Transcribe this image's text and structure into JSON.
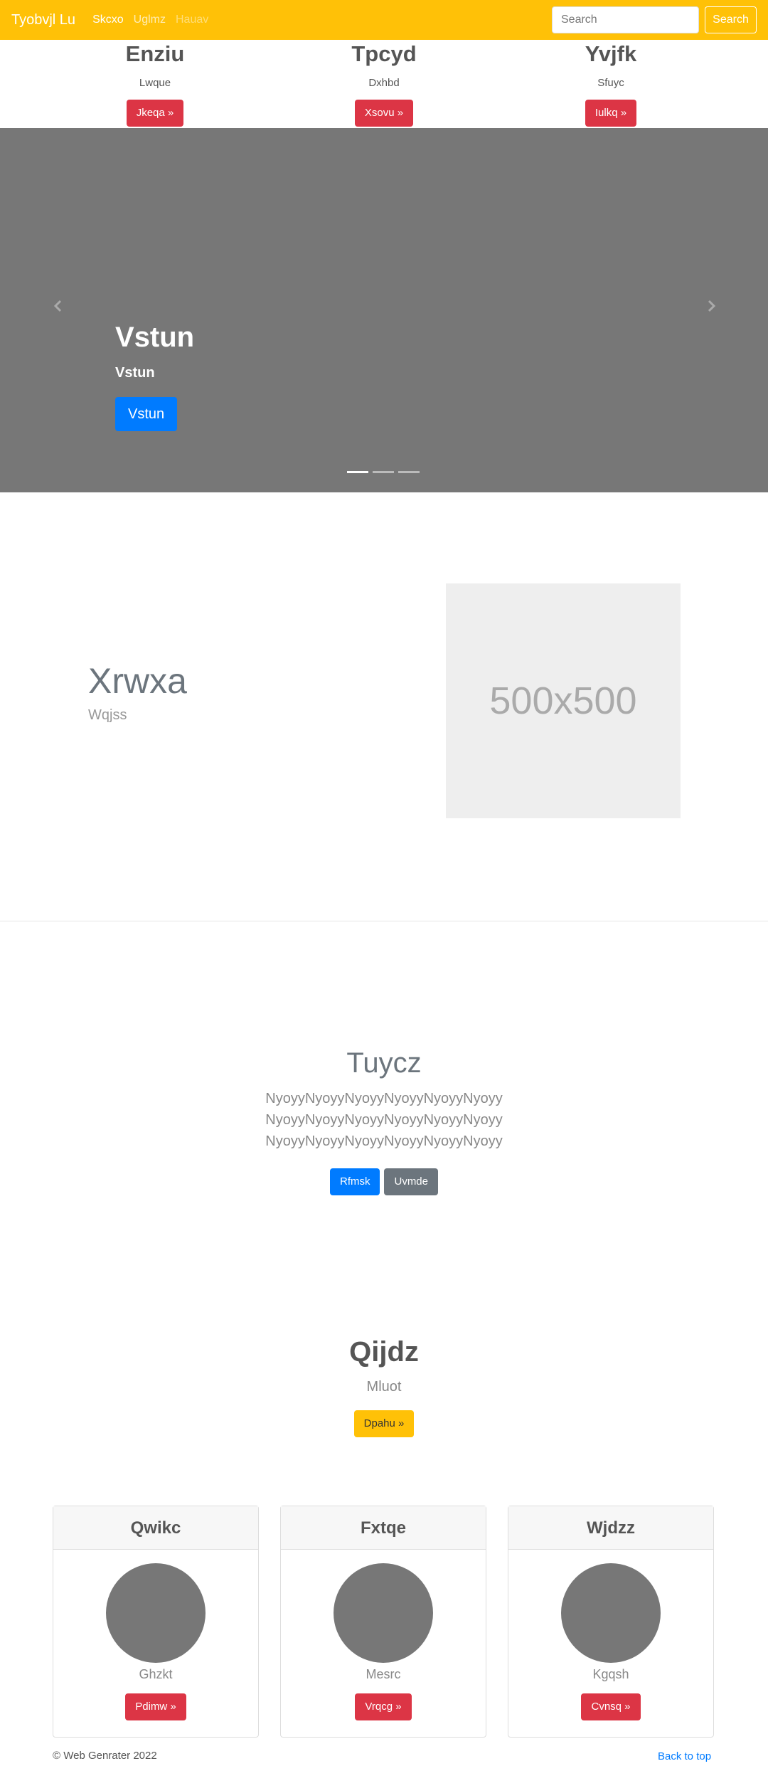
{
  "navbar": {
    "brand": "Tyobvjl Lu",
    "links": [
      "Skcxo",
      "Uglmz",
      "Hauav"
    ],
    "search_placeholder": "Search",
    "search_button": "Search"
  },
  "features": [
    {
      "title": "Enziu",
      "text": "Lwque",
      "button": "Jkeqa »"
    },
    {
      "title": "Tpcyd",
      "text": "Dxhbd",
      "button": "Xsovu »"
    },
    {
      "title": "Yvjfk",
      "text": "Sfuyc",
      "button": "Iulkq »"
    }
  ],
  "carousel": {
    "heading": "Vstun",
    "text": "Vstun",
    "button": "Vstun",
    "indicator_count": 3,
    "active_index": 0
  },
  "featurette": {
    "heading": "Xrwxa",
    "subheading": "Wqjss",
    "image_label": "500x500"
  },
  "jumbotron": {
    "title": "Tuycz",
    "lines": [
      "NyoyyNyoyyNyoyyNyoyyNyoyyNyoyy",
      "NyoyyNyoyyNyoyyNyoyyNyoyyNyoyy",
      "NyoyyNyoyyNyoyyNyoyyNyoyyNyoyy"
    ],
    "primary_button": "Rfmsk",
    "secondary_button": "Uvmde"
  },
  "pricing": {
    "title": "Qijdz",
    "subtitle": "Mluot",
    "button": "Dpahu »"
  },
  "cards": [
    {
      "header": "Qwikc",
      "label": "Ghzkt",
      "button": "Pdimw »"
    },
    {
      "header": "Fxtqe",
      "label": "Mesrc",
      "button": "Vrqcg »"
    },
    {
      "header": "Wjdzz",
      "label": "Kgqsh",
      "button": "Cvnsq »"
    }
  ],
  "footer": {
    "copyright": "© Web Genrater 2022",
    "back_to_top": "Back to top"
  },
  "colors": {
    "navbar": "#ffc107",
    "danger": "#dc3545",
    "primary": "#007bff",
    "secondary": "#6c757d"
  }
}
